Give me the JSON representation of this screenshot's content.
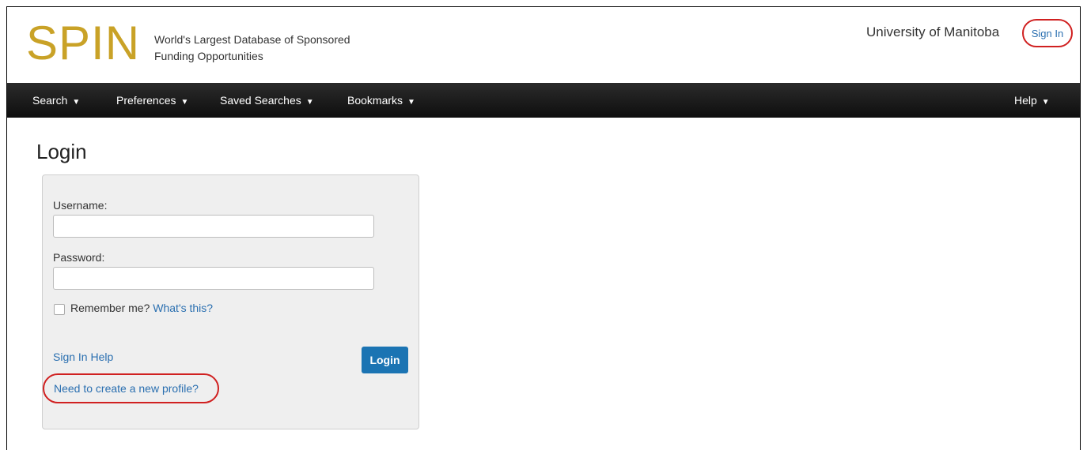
{
  "header": {
    "logo": "SPIN",
    "tagline_line1": "World's Largest Database of Sponsored",
    "tagline_line2": "Funding Opportunities",
    "institution": "University of Manitoba",
    "sign_in": "Sign In"
  },
  "nav": {
    "items": [
      {
        "label": "Search",
        "caret": "▼"
      },
      {
        "label": "Preferences",
        "caret": "▼"
      },
      {
        "label": "Saved Searches",
        "caret": "▼"
      },
      {
        "label": "Bookmarks",
        "caret": "▼"
      }
    ],
    "help": {
      "label": "Help",
      "caret": "▼"
    }
  },
  "login": {
    "title": "Login",
    "username_label": "Username:",
    "username_value": "",
    "password_label": "Password:",
    "password_value": "",
    "remember_label": "Remember me?",
    "remember_checked": false,
    "whats_this": "What's this?",
    "sign_in_help": "Sign In Help",
    "login_button": "Login",
    "new_profile": "Need to create a new profile?"
  },
  "colors": {
    "logo": "#c9a227",
    "link": "#2a6fb0",
    "button": "#1b74b3",
    "highlight": "#d02020",
    "nav_bg": "#151515"
  }
}
